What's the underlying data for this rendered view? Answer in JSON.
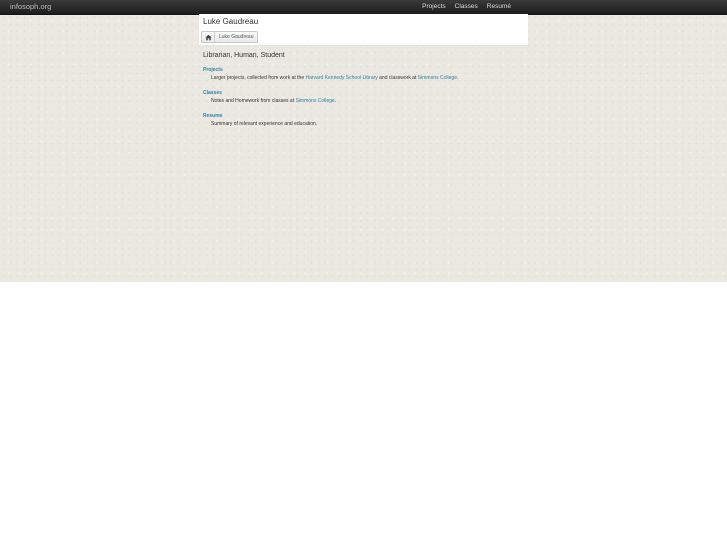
{
  "site": {
    "brand": "infosoph.org"
  },
  "nav": {
    "items": [
      "Projects",
      "Classes",
      "Resumé"
    ]
  },
  "header": {
    "title": "Luke Gaudreau",
    "breadcrumb": {
      "label": "Luke Gaudreau"
    }
  },
  "main": {
    "tagline": "Librarian, Human, Student",
    "sections": [
      {
        "title": "Projects",
        "desc_start": "Larger projects, collected from work at the ",
        "link1": "Harvard Kennedy School Library",
        "desc_mid": " and classwork at ",
        "link2": "Simmons College",
        "desc_end": "."
      },
      {
        "title": "Classes",
        "desc_start": "Notes and Homework from classes at ",
        "link1": "Simmons College",
        "desc_end": "."
      },
      {
        "title": "Resume",
        "desc_start": "Summary of relevant experience and education."
      }
    ]
  },
  "colors": {
    "link": "#2a83a8",
    "topbar": "#2a2a2a",
    "background": "#ebe8e1"
  }
}
